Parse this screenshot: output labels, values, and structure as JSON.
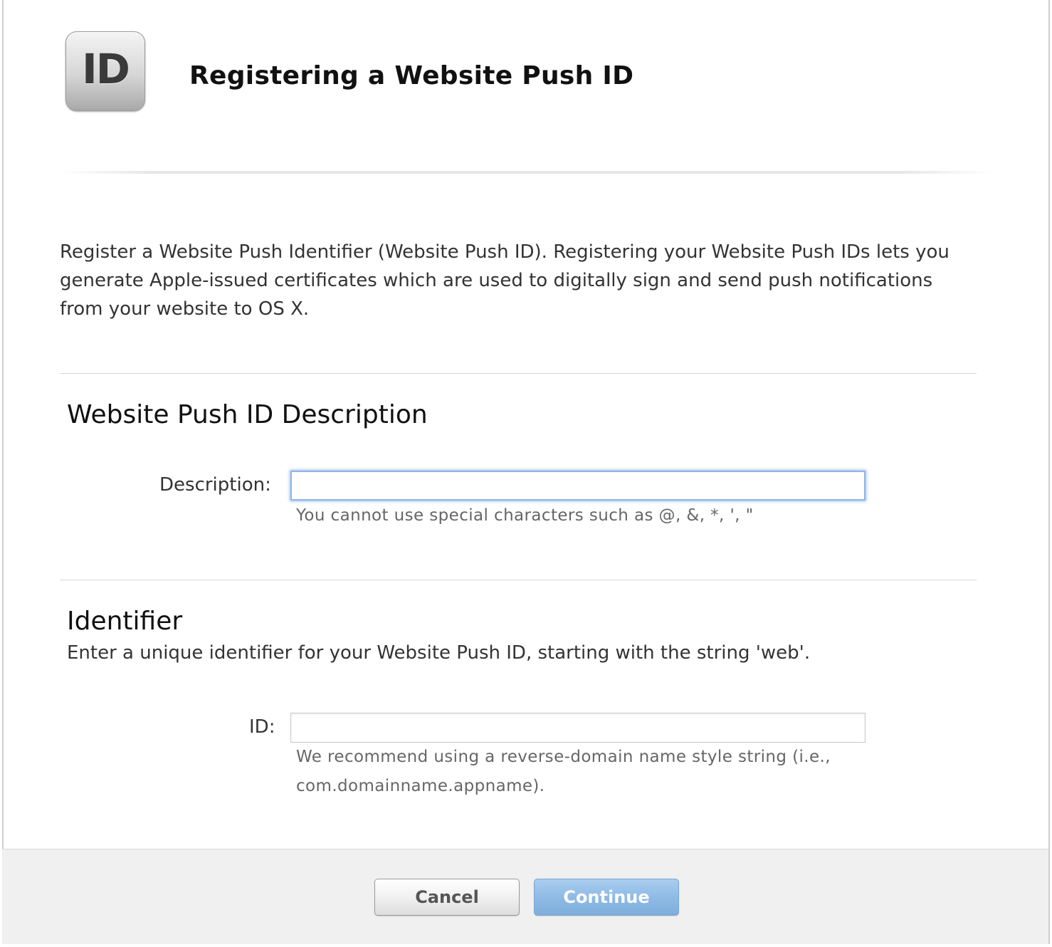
{
  "header": {
    "icon_text": "ID",
    "icon_name": "id-badge-icon",
    "title": "Registering a Website Push ID"
  },
  "intro": {
    "text": "Register a Website Push Identifier (Website Push ID). Registering your Website Push IDs lets you generate Apple-issued certificates which are used to digitally sign and send push notifications from your website to OS X."
  },
  "description_section": {
    "title": "Website Push ID Description",
    "field_label": "Description:",
    "field_value": "",
    "field_placeholder": "",
    "hint": "You cannot use special characters such as @, &, *, ', \""
  },
  "identifier_section": {
    "title": "Identifier",
    "subtitle": "Enter a unique identifier for your Website Push ID, starting with the string 'web'.",
    "field_label": "ID:",
    "field_value": "",
    "field_placeholder": "",
    "hint": "We recommend using a reverse-domain name style string (i.e., com.domainname.appname)."
  },
  "footer": {
    "cancel_label": "Cancel",
    "continue_label": "Continue"
  },
  "colors": {
    "continue_button": "#8fbbe5",
    "focus_ring": "#8fb4e6",
    "footer_background": "#f0f0f0"
  }
}
